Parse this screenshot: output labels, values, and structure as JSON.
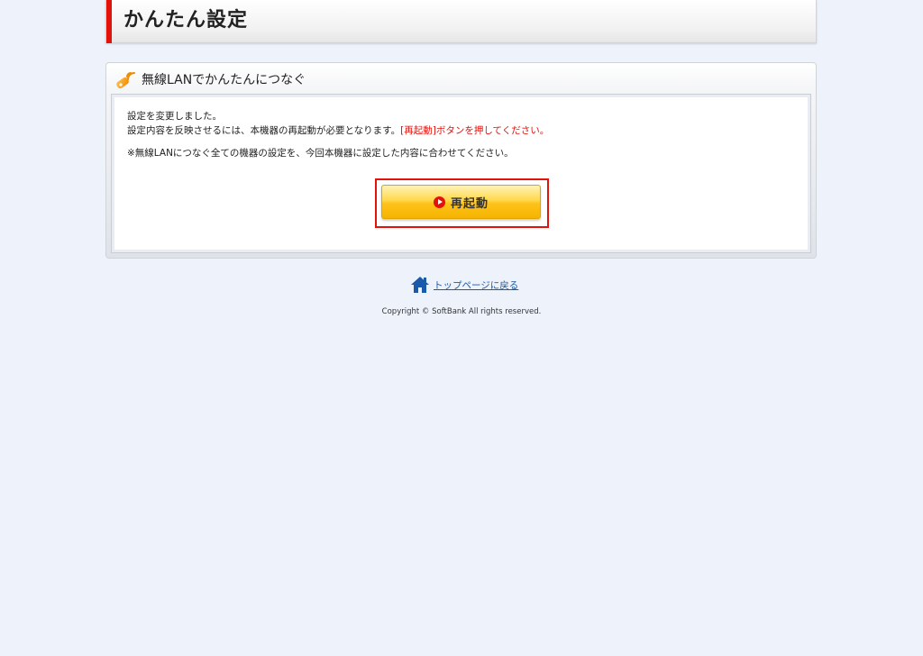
{
  "header": {
    "title": "かんたん設定",
    "accent_color": "#e3120b"
  },
  "panel": {
    "icon": "wifi-antenna-icon",
    "heading": "無線LANでかんたんにつなぐ",
    "line1": "設定を変更しました。",
    "line2_prefix": "設定内容を反映させるには、本機器の再起動が必要となります。",
    "line2_red": "[再起動]ボタンを押してください。",
    "line3": "※無線LANにつなぐ全ての機器の設定を、今回本機器に設定した内容に合わせてください。",
    "restart_button_label": "再起動"
  },
  "footer": {
    "home_icon": "home-icon",
    "top_link": "トップページに戻る",
    "copyright": "Copyright © SoftBank All rights reserved."
  }
}
